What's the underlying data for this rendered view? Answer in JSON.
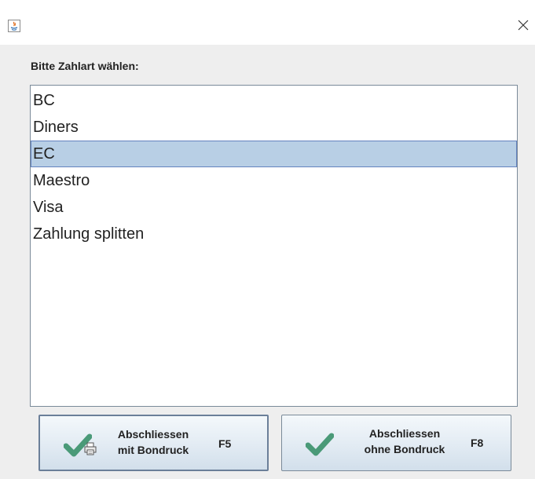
{
  "window": {
    "close_glyph": "✕"
  },
  "dialog": {
    "prompt": "Bitte Zahlart wählen:",
    "payment_methods": [
      "BC",
      "Diners",
      "EC",
      "Maestro",
      "Visa",
      "Zahlung splitten"
    ],
    "selected": "EC"
  },
  "buttons": {
    "with_receipt": {
      "line1": "Abschliessen",
      "line2": "mit Bondruck",
      "shortcut": "F5"
    },
    "without_receipt": {
      "line1": "Abschliessen",
      "line2": "ohne Bondruck",
      "shortcut": "F8"
    }
  },
  "colors": {
    "selection_background": "#b8cfe5",
    "selection_border": "#6382bf",
    "check_green": "#4a9a78"
  },
  "icons": [
    "java-app-icon",
    "close-icon",
    "checkmark-icon",
    "printer-icon"
  ]
}
